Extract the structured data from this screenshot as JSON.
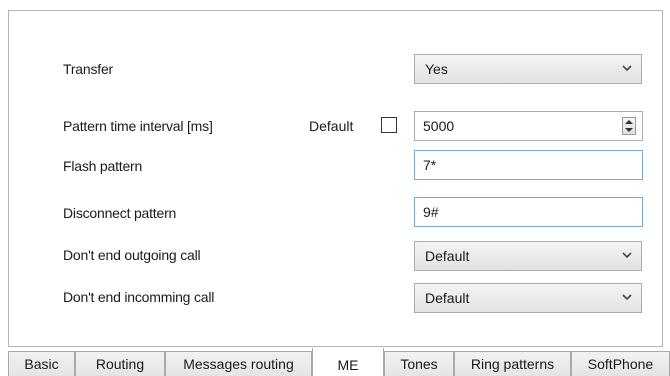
{
  "form": {
    "transfer": {
      "label": "Transfer",
      "value": "Yes"
    },
    "pattern_interval": {
      "label": "Pattern time interval [ms]",
      "default_label": "Default",
      "default_checked": false,
      "value": "5000"
    },
    "flash_pattern": {
      "label": "Flash pattern",
      "value": "7*"
    },
    "disconnect_pattern": {
      "label": "Disconnect pattern",
      "value": "9#"
    },
    "dont_end_outgoing": {
      "label": "Don't end outgoing call",
      "value": "Default"
    },
    "dont_end_incoming": {
      "label": "Don't end incomming call",
      "value": "Default"
    }
  },
  "tabs": [
    {
      "label": "Basic"
    },
    {
      "label": "Routing"
    },
    {
      "label": "Messages routing"
    },
    {
      "label": "ME",
      "active": true
    },
    {
      "label": "Tones"
    },
    {
      "label": "Ring patterns"
    },
    {
      "label": "SoftPhone"
    }
  ],
  "icons": {
    "dropdown": "chevron-down-icon",
    "spinner": "spinner-arrows-icon"
  }
}
